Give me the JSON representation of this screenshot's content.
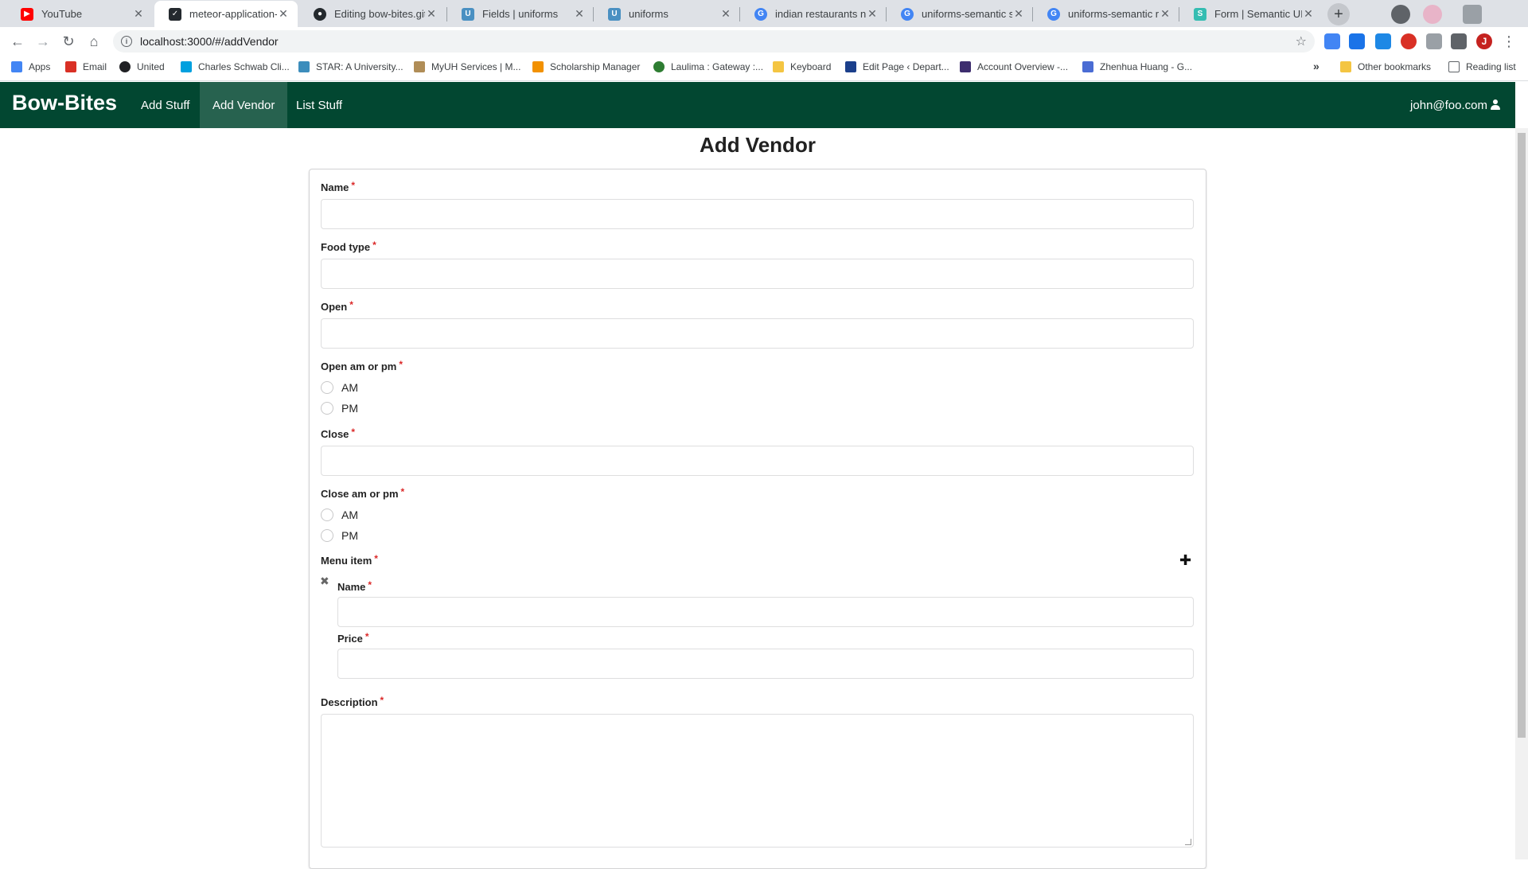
{
  "browser": {
    "tabs": [
      {
        "title": "YouTube",
        "color": "#ff0000",
        "glyph": "▶"
      },
      {
        "title": "meteor-application-te",
        "color": "#24292e",
        "glyph": "✓"
      },
      {
        "title": "Editing bow-bites.gith",
        "color": "#24292e",
        "glyph": "●"
      },
      {
        "title": "Fields | uniforms",
        "color": "#4a90c2",
        "glyph": "U"
      },
      {
        "title": "uniforms",
        "color": "#4a90c2",
        "glyph": "U"
      },
      {
        "title": "indian restaurants nea",
        "color": "#4285f4",
        "glyph": "G"
      },
      {
        "title": "uniforms-semantic sw",
        "color": "#4285f4",
        "glyph": "G"
      },
      {
        "title": "uniforms-semantic rac",
        "color": "#4285f4",
        "glyph": "G"
      },
      {
        "title": "Form | Semantic UI",
        "color": "#35bdb2",
        "glyph": "S"
      }
    ],
    "close_glyph": "✕",
    "new_tab_glyph": "+",
    "url": "localhost:3000/#/addVendor",
    "profile_initial": "J",
    "bookmarks": [
      {
        "label": "Apps",
        "color": "#4285f4"
      },
      {
        "label": "Email",
        "color": "#d93025"
      },
      {
        "label": "United",
        "color": "#202124"
      },
      {
        "label": "Charles Schwab Cli...",
        "color": "#00a0df"
      },
      {
        "label": "STAR: A University...",
        "color": "#3c8dbc"
      },
      {
        "label": "MyUH Services | M...",
        "color": "#b08d57"
      },
      {
        "label": "Scholarship Manager",
        "color": "#f29100"
      },
      {
        "label": "Laulima : Gateway :...",
        "color": "#2e7d32"
      },
      {
        "label": "Keyboard",
        "color": "#f4c542"
      },
      {
        "label": "Edit Page ‹ Depart...",
        "color": "#1b3f8b"
      },
      {
        "label": "Account Overview -...",
        "color": "#3d2d6e"
      },
      {
        "label": "Zhenhua Huang - G...",
        "color": "#4a6cd4"
      }
    ],
    "overflow_glyph": "»",
    "other_bookmarks": "Other bookmarks",
    "reading_list": "Reading list"
  },
  "app": {
    "brand": "Bow-Bites",
    "nav": [
      "Add Stuff",
      "Add Vendor",
      "List Stuff"
    ],
    "user": "john@foo.com",
    "accent": "#024731"
  },
  "form": {
    "title": "Add Vendor",
    "required_mark": "*",
    "fields": {
      "name": "Name",
      "food_type": "Food type",
      "open": "Open",
      "open_ampm": "Open am or pm",
      "close": "Close",
      "close_ampm": "Close am or pm",
      "menu_item": "Menu item",
      "menu_name": "Name",
      "menu_price": "Price",
      "description": "Description"
    },
    "am": "AM",
    "pm": "PM",
    "add_glyph": "✚",
    "remove_glyph": "✖"
  }
}
